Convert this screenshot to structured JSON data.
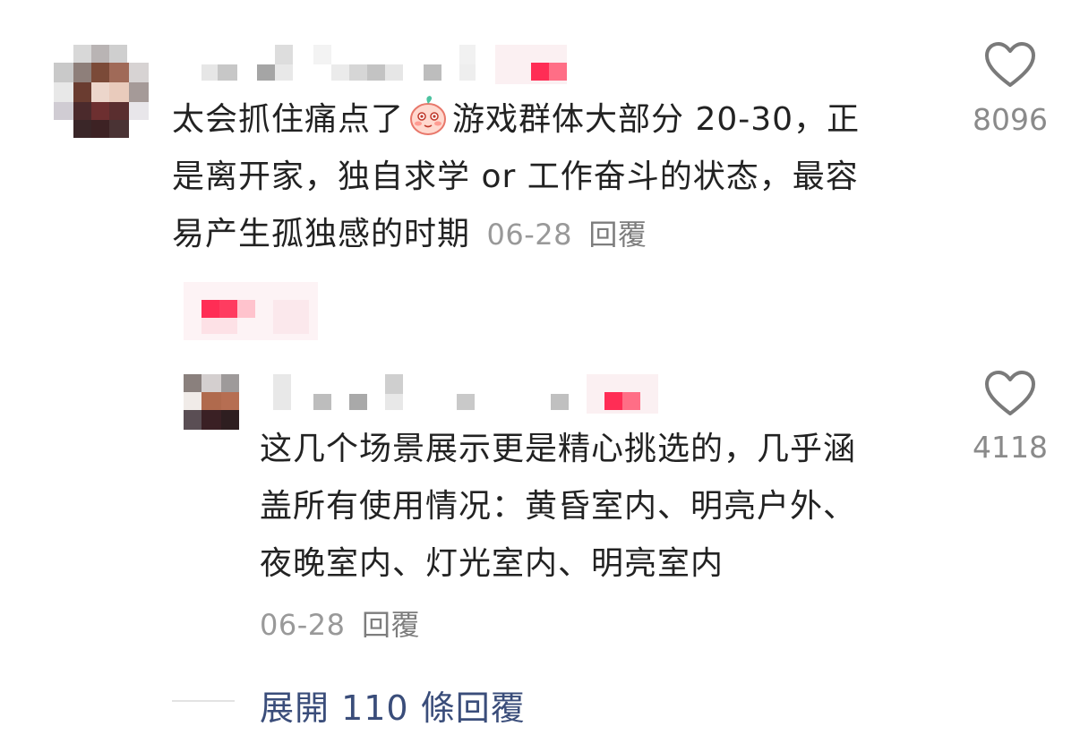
{
  "comment": {
    "text_line1": "太会抓住痛点了",
    "text_line1b": "游戏群体大部分 20-30，正",
    "text_line2": "是离开家，独自求学 or 工作奋斗的状态，最容",
    "text_line3": "易产生孤独感的时期",
    "date": "06-28",
    "reply_label": "回覆",
    "likes": "8096",
    "emoji_icon": "blushing-face-emoji",
    "accent_color": "#ff2d55"
  },
  "reply": {
    "text_line1": "这几个场景展示更是精心挑选的，几乎涵",
    "text_line2": "盖所有使用情况：黄昏室内、明亮户外、",
    "text_line3": "夜晚室内、灯光室内、明亮室内",
    "date": "06-28",
    "reply_label": "回覆",
    "likes": "4118"
  },
  "expand": {
    "label": "展開 110 條回覆"
  }
}
